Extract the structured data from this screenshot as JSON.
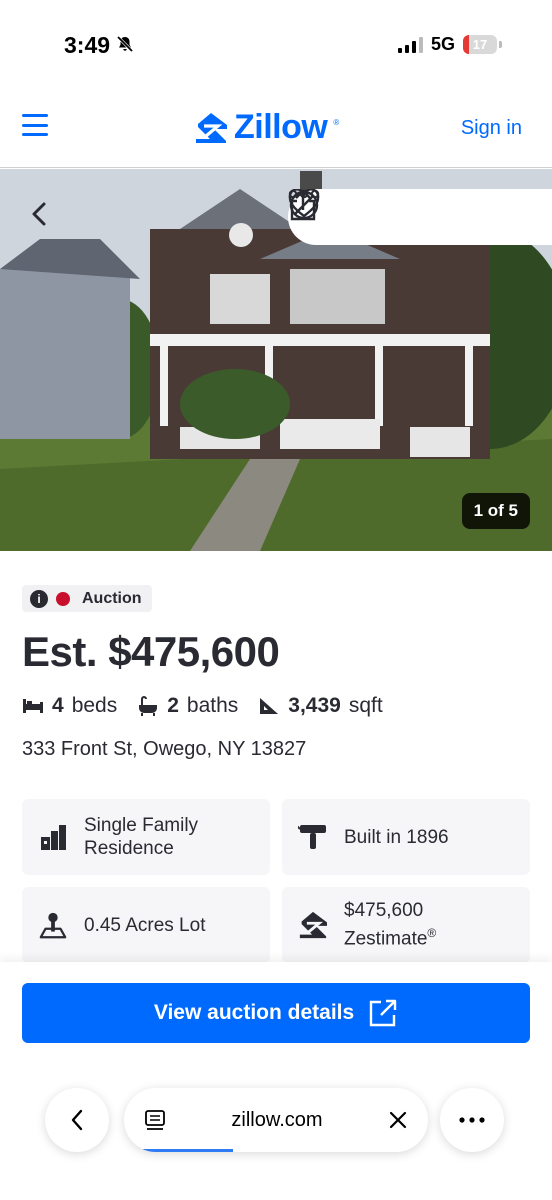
{
  "status_bar": {
    "time": "3:49",
    "network": "5G",
    "battery_level": "17",
    "battery_fraction": 0.17
  },
  "header": {
    "logo_text": "Zillow",
    "logo_registered": "®",
    "sign_in_label": "Sign in"
  },
  "photo": {
    "counter": "1 of 5"
  },
  "listing": {
    "status_badge": "Auction",
    "price": "Est. $475,600",
    "beds_value": "4",
    "beds_label": "beds",
    "baths_value": "2",
    "baths_label": "baths",
    "sqft_value": "3,439",
    "sqft_label": "sqft",
    "address": "333 Front St, Owego, NY 13827"
  },
  "highlights": [
    {
      "icon": "building-icon",
      "line1": "Single Family",
      "line2": "Residence"
    },
    {
      "icon": "hammer-icon",
      "line1": "Built in 1896",
      "line2": ""
    },
    {
      "icon": "lot-icon",
      "line1": "0.45 Acres Lot",
      "line2": ""
    },
    {
      "icon": "zestimate-icon",
      "line1": "$475,600",
      "line2": "Zestimate",
      "sup": "®"
    }
  ],
  "cta": {
    "label": "View auction details"
  },
  "browser": {
    "url": "zillow.com",
    "load_progress": 0.36
  },
  "colors": {
    "brand_blue": "#006aff",
    "text": "#2a2a33",
    "auction_red": "#c8102e",
    "card_bg": "#f6f6f8"
  }
}
